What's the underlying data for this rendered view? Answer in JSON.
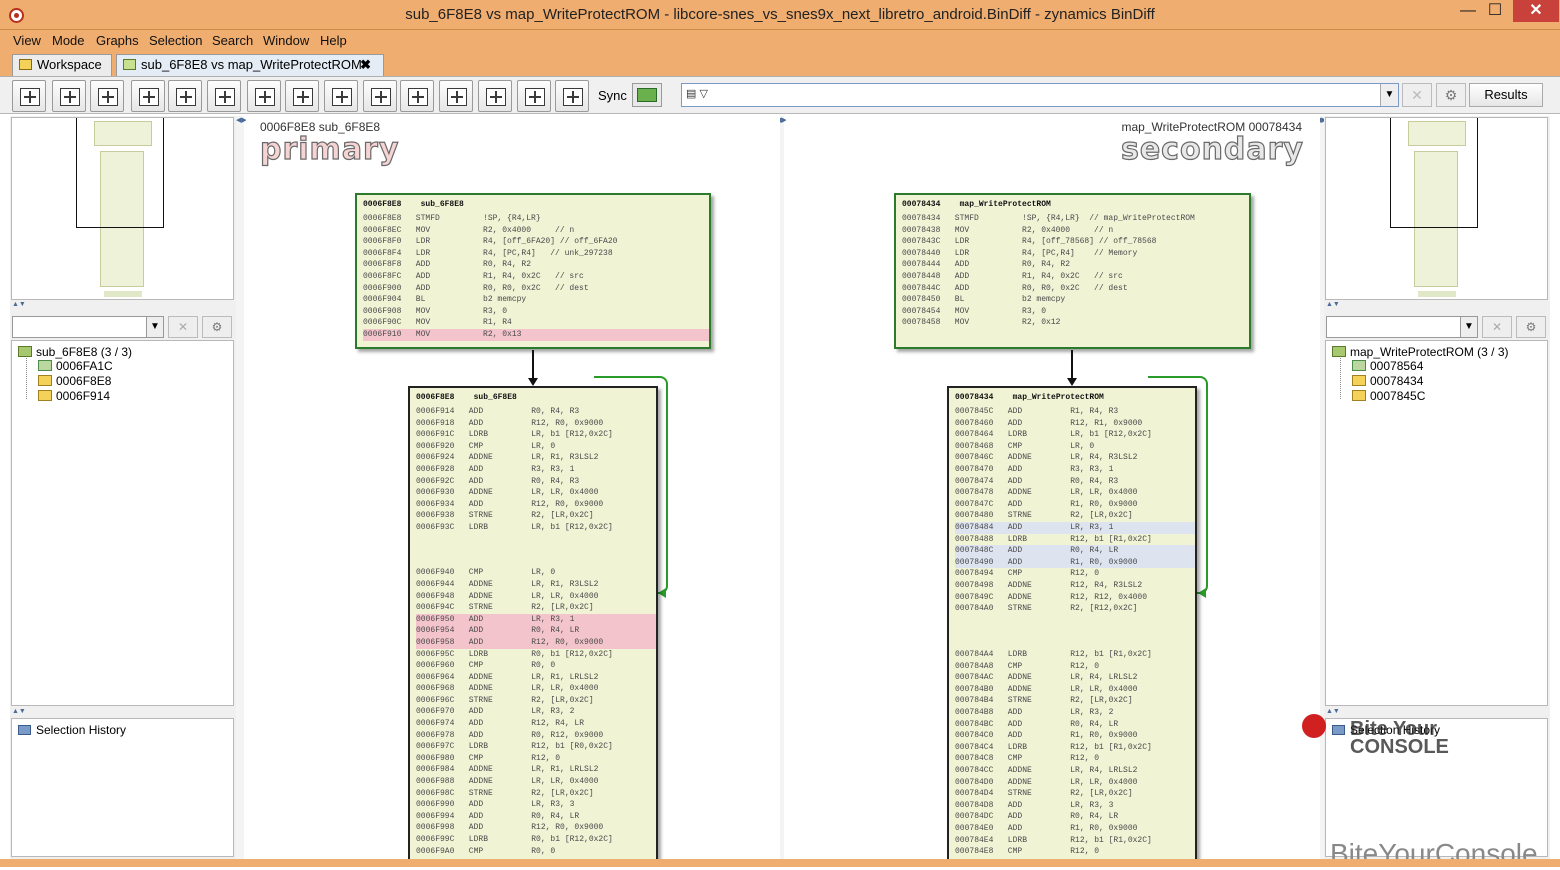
{
  "window": {
    "title": "sub_6F8E8 vs map_WriteProtectROM - libcore-snes_vs_snes9x_next_libretro_android.BinDiff - zynamics BinDiff",
    "minimize": "—",
    "maximize": "☐",
    "close": "✕"
  },
  "menu": [
    "View",
    "Mode",
    "Graphs",
    "Selection",
    "Search",
    "Window",
    "Help"
  ],
  "tabs": {
    "workspace": "Workspace",
    "compare": "sub_6F8E8 vs map_WriteProtectROM",
    "close_glyph": "✖"
  },
  "toolbar": {
    "sync_label": "Sync",
    "results_label": "Results",
    "search_value": "",
    "clear_glyph": "✕",
    "settings_glyph": "⚙",
    "dropdown_glyph": "▼"
  },
  "left_panel": {
    "tree_root": "sub_6F8E8 (3 / 3)",
    "tree_items": [
      "0006FA1C",
      "0006F8E8",
      "0006F914"
    ],
    "history_label": "Selection History"
  },
  "right_panel": {
    "tree_root": "map_WriteProtectROM (3 / 3)",
    "tree_items": [
      "00078564",
      "00078434",
      "0007845C"
    ],
    "history_label": "Selection History"
  },
  "primary": {
    "header": "0006F8E8   sub_6F8E8",
    "word": "primary",
    "block1_header": "0006F8E8    sub_6F8E8",
    "block1": [
      "0006F8E8   STMFD         !SP, {R4,LR}",
      "0006F8EC   MOV           R2, 0x4000     // n",
      "0006F8F0   LDR           R4, [off_6FA20] // off_6FA20",
      "0006F8F4   LDR           R4, [PC,R4]   // unk_297238",
      "0006F8F8   ADD           R0, R4, R2",
      "0006F8FC   ADD           R1, R4, 0x2C   // src",
      "0006F900   ADD           R0, R0, 0x2C   // dest",
      "0006F904   BL            b2 memcpy",
      "0006F908   MOV           R3, 0",
      "0006F90C   MOV           R1, R4",
      "0006F910   MOV           R2, 0x13"
    ],
    "block2_header": "0006F8E8    sub_6F8E8",
    "block2": [
      "0006F914   ADD          R0, R4, R3",
      "0006F918   ADD          R12, R0, 0x9000",
      "0006F91C   LDRB         LR, b1 [R12,0x2C]",
      "0006F920   CMP          LR, 0",
      "0006F924   ADDNE        LR, R1, R3LSL2",
      "0006F928   ADD          R3, R3, 1",
      "0006F92C   ADD          R0, R4, R3",
      "0006F930   ADDNE        LR, LR, 0x4000",
      "0006F934   ADD          R12, R0, 0x9000",
      "0006F938   STRNE        R2, [LR,0x2C]",
      "0006F93C   LDRB         LR, b1 [R12,0x2C]",
      "0006F940   CMP          LR, 0",
      "0006F944   ADDNE        LR, R1, R3LSL2",
      "0006F948   ADDNE        LR, LR, 0x4000",
      "0006F94C   STRNE        R2, [LR,0x2C]",
      "0006F950   ADD          LR, R3, 1",
      "0006F954   ADD          R0, R4, LR",
      "0006F958   ADD          R12, R0, 0x9000",
      "0006F95C   LDRB         R0, b1 [R12,0x2C]",
      "0006F960   CMP          R0, 0",
      "0006F964   ADDNE        LR, R1, LRLSL2",
      "0006F968   ADDNE        LR, LR, 0x4000",
      "0006F96C   STRNE        R2, [LR,0x2C]",
      "0006F970   ADD          LR, R3, 2",
      "0006F974   ADD          R12, R4, LR",
      "0006F978   ADD          R0, R12, 0x9000",
      "0006F97C   LDRB         R12, b1 [R0,0x2C]",
      "0006F980   CMP          R12, 0",
      "0006F984   ADDNE        LR, R1, LRLSL2",
      "0006F988   ADDNE        LR, LR, 0x4000",
      "0006F98C   STRNE        R2, [LR,0x2C]",
      "0006F990   ADD          LR, R3, 3",
      "0006F994   ADD          R0, R4, LR",
      "0006F998   ADD          R12, R0, 0x9000",
      "0006F99C   LDRB         R0, b1 [R12,0x2C]",
      "0006F9A0   CMP          R0, 0"
    ]
  },
  "secondary": {
    "header": "map_WriteProtectROM   00078434",
    "word": "secondary",
    "block1_header": "00078434    map_WriteProtectROM",
    "block1": [
      "00078434   STMFD         !SP, {R4,LR}  // map_WriteProtectROM",
      "00078438   MOV           R2, 0x4000     // n",
      "0007843C   LDR           R4, [off_78568] // off_78568",
      "00078440   LDR           R4, [PC,R4]    // Memory",
      "00078444   ADD           R0, R4, R2",
      "00078448   ADD           R1, R4, 0x2C   // src",
      "0007844C   ADD           R0, R0, 0x2C   // dest",
      "00078450   BL            b2 memcpy",
      "00078454   MOV           R3, 0",
      "00078458   MOV           R2, 0x12"
    ],
    "block2_header": "00078434    map_WriteProtectROM",
    "block2": [
      "0007845C   ADD          R1, R4, R3",
      "00078460   ADD          R12, R1, 0x9000",
      "00078464   LDRB         LR, b1 [R12,0x2C]",
      "00078468   CMP          LR, 0",
      "0007846C   ADDNE        LR, R4, R3LSL2",
      "00078470   ADD          R3, R3, 1",
      "00078474   ADD          R0, R4, R3",
      "00078478   ADDNE        LR, LR, 0x4000",
      "0007847C   ADD          R1, R0, 0x9000",
      "00078480   STRNE        R2, [LR,0x2C]",
      "00078484   ADD          LR, R3, 1",
      "00078488   LDRB         R12, b1 [R1,0x2C]",
      "0007848C   ADD          R0, R4, LR",
      "00078490   ADD          R1, R0, 0x9000",
      "00078494   CMP          R12, 0",
      "00078498   ADDNE        R12, R4, R3LSL2",
      "0007849C   ADDNE        R12, R12, 0x4000",
      "000784A0   STRNE        R2, [R12,0x2C]",
      "000784A4   LDRB         R12, b1 [R1,0x2C]",
      "000784A8   CMP          R12, 0",
      "000784AC   ADDNE        LR, R4, LRLSL2",
      "000784B0   ADDNE        LR, LR, 0x4000",
      "000784B4   STRNE        R2, [LR,0x2C]",
      "000784B8   ADD          LR, R3, 2",
      "000784BC   ADD          R0, R4, LR",
      "000784C0   ADD          R1, R0, 0x9000",
      "000784C4   LDRB         R12, b1 [R1,0x2C]",
      "000784C8   CMP          R12, 0",
      "000784CC   ADDNE        LR, R4, LRLSL2",
      "000784D0   ADDNE        LR, LR, 0x4000",
      "000784D4   STRNE        R2, [LR,0x2C]",
      "000784D8   ADD          LR, R3, 3",
      "000784DC   ADD          R0, R4, LR",
      "000784E0   ADD          R1, R0, 0x9000",
      "000784E4   LDRB         R12, b1 [R1,0x2C]",
      "000784E8   CMP          R12, 0"
    ]
  },
  "watermark": {
    "line1": "Bite Your",
    "line2": "CONSOLE",
    "bottom": "BiteYourConsole"
  },
  "colors": {
    "title_bar": "#f0ad70",
    "node_fill": "#f1f3d5",
    "node_border_green": "#2c7a2c",
    "highlight_pink": "#f4c4cc",
    "highlight_blue": "#dde4f0"
  }
}
